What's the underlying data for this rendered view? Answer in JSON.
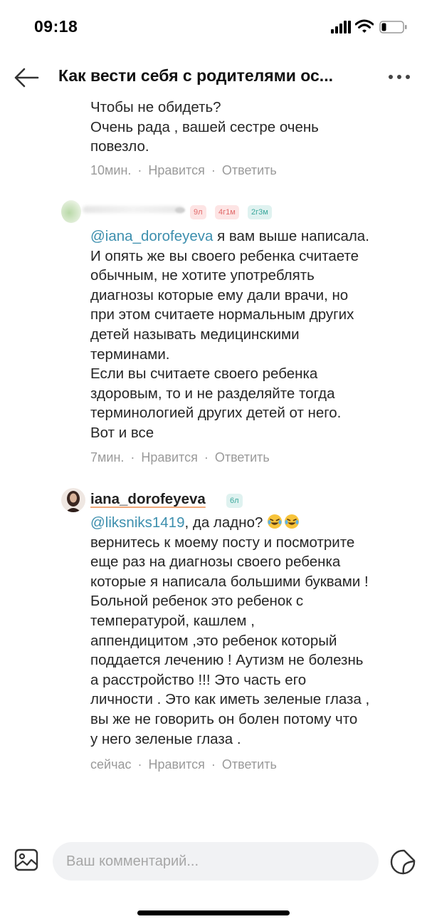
{
  "status": {
    "time": "09:18"
  },
  "header": {
    "title": "Как вести себя с родителями ос..."
  },
  "comments": [
    {
      "lines": [
        "Чтобы не обидеть?",
        "Очень рада , вашей сестре очень",
        "повезло."
      ],
      "time": "10мин.",
      "like": "Нравится",
      "reply": "Ответить"
    },
    {
      "badges": [
        "9л",
        "4г1м",
        "2г3м"
      ],
      "mention": "@iana_dorofeyeva",
      "first_line_rest": " я вам выше написала.",
      "lines": [
        "И опять же вы своего ребенка считаете",
        "обычным, не хотите употреблять",
        "диагнозы которые ему дали врачи, но",
        "при этом считаете нормальным других",
        "детей называть медицинскими",
        "терминами.",
        "Если вы считаете своего ребенка",
        "здоровым, то и не разделяйте тогда",
        "терминологией других детей от него.",
        "Вот и все"
      ],
      "time": "7мин.",
      "like": "Нравится",
      "reply": "Ответить"
    },
    {
      "username": "iana_dorofeyeva",
      "badge": "6л",
      "mention": "@liksniks1419",
      "first_line_rest": ", да ладно? ",
      "lines": [
        "вернитесь к моему посту и посмотрите",
        "еще раз на диагнозы своего ребенка",
        "которые я написала большими буквами !",
        "Больной ребенок это ребенок с",
        "температурой, кашлем ,",
        "аппендицитом ,это ребенок который",
        "поддается лечению !  Аутизм не болезнь",
        "а расстройство !!! Это часть его",
        "личности . Это как иметь зеленые глаза ,",
        "вы же не говорить он болен потому что",
        "у него зеленые глаза ."
      ],
      "time": "сейчас",
      "like": "Нравится",
      "reply": "Ответить"
    }
  ],
  "input": {
    "placeholder": "Ваш комментарий..."
  },
  "icons": {
    "back": "arrow-left-icon",
    "more": "more-dots-icon",
    "image": "image-icon",
    "sticker": "sticker-icon",
    "emoji": "laughing-tears-emoji"
  },
  "colors": {
    "mention": "#3d8fae",
    "meta": "#9a9a9a",
    "input_bg": "#f1f2f4"
  }
}
